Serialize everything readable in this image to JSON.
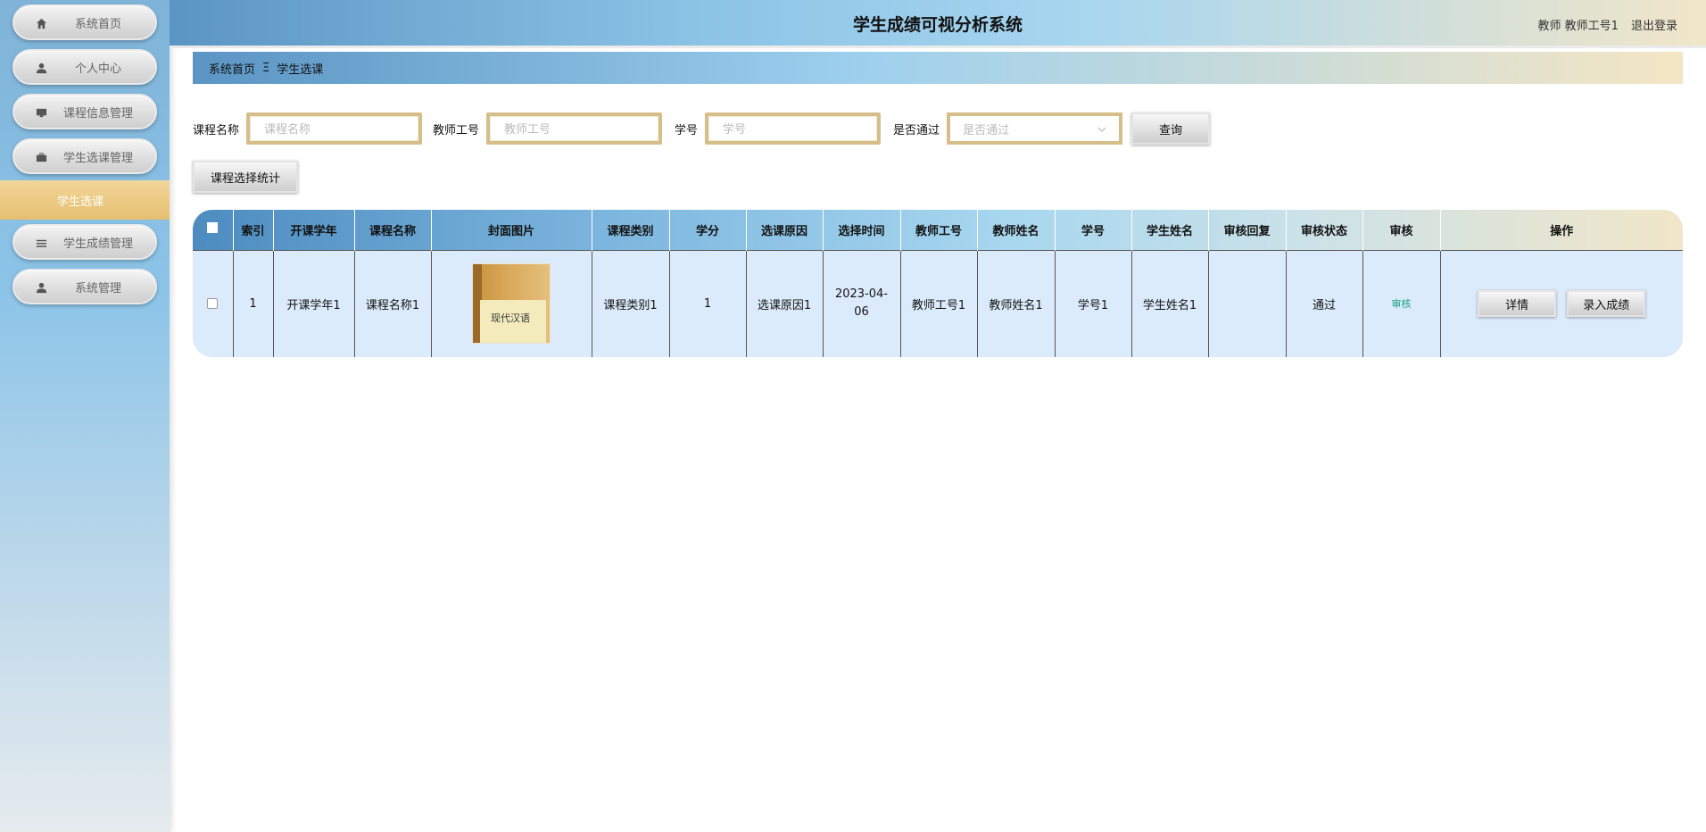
{
  "app": {
    "title": "学生成绩可视分析系统",
    "user_label": "教师 教师工号1",
    "logout_label": "退出登录"
  },
  "sidebar": {
    "items": [
      {
        "label": "系统首页",
        "icon": "home-icon"
      },
      {
        "label": "个人中心",
        "icon": "user-icon"
      },
      {
        "label": "课程信息管理",
        "icon": "monitor-icon"
      },
      {
        "label": "学生选课管理",
        "icon": "briefcase-icon"
      },
      {
        "label": "学生成绩管理",
        "icon": "list-icon"
      },
      {
        "label": "系统管理",
        "icon": "user-icon"
      }
    ],
    "active_sub": "学生选课"
  },
  "breadcrumb": {
    "home": "系统首页",
    "separator": "Ξ",
    "current": "学生选课"
  },
  "search": {
    "course_name_label": "课程名称",
    "course_name_placeholder": "课程名称",
    "teacher_no_label": "教师工号",
    "teacher_no_placeholder": "教师工号",
    "student_no_label": "学号",
    "student_no_placeholder": "学号",
    "passed_label": "是否通过",
    "passed_placeholder": "是否通过",
    "query_button": "查询"
  },
  "stat_button": "课程选择统计",
  "table": {
    "columns": [
      "索引",
      "开课学年",
      "课程名称",
      "封面图片",
      "课程类别",
      "学分",
      "选课原因",
      "选择时间",
      "教师工号",
      "教师姓名",
      "学号",
      "学生姓名",
      "审核回复",
      "审核状态",
      "审核",
      "操作"
    ],
    "rows": [
      {
        "index": "1",
        "year": "开课学年1",
        "course_name": "课程名称1",
        "cover_text": "现代汉语",
        "category": "课程类别1",
        "credit": "1",
        "reason": "选课原因1",
        "time": "2023-04-06",
        "teacher_no": "教师工号1",
        "teacher_name": "教师姓名1",
        "student_no": "学号1",
        "student_name": "学生姓名1",
        "reply": "",
        "status": "通过",
        "audit_link": "审核",
        "detail_button": "详情",
        "grade_button": "录入成绩"
      }
    ]
  },
  "colors": {
    "accent_gold": "#d6be8a",
    "active_menu": "#e6bf70",
    "row_bg": "#dcebfb",
    "audit_link": "#1aa083"
  }
}
